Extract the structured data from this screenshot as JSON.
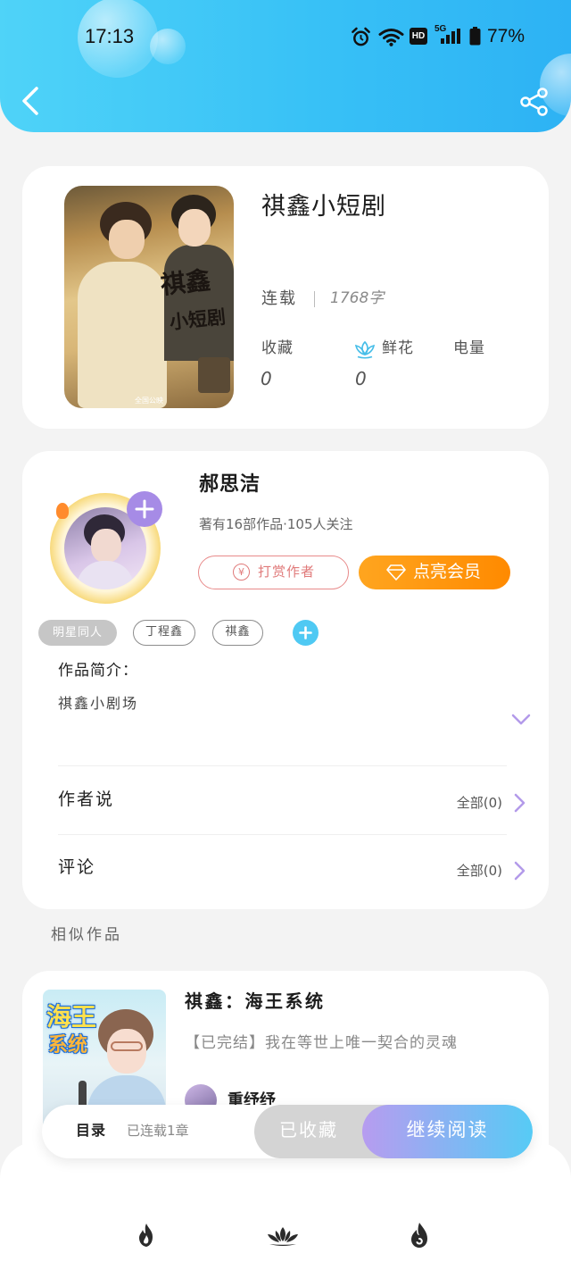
{
  "status_bar": {
    "time": "17:13",
    "hd_label": "HD",
    "network_label": "5G",
    "battery_percent": "77%",
    "icons": [
      "alarm-icon",
      "wifi-icon",
      "hd-icon",
      "signal-icon",
      "battery-icon"
    ]
  },
  "header": {
    "back_icon": "back-chevron-icon",
    "share_icon": "share-icon"
  },
  "book": {
    "title": "祺鑫小短剧",
    "status": "连载",
    "word_count": "1768字",
    "stats": [
      {
        "label": "收藏",
        "value": "0"
      },
      {
        "label": "鲜花",
        "value": "0",
        "icon": "lotus-icon"
      },
      {
        "label": "电量"
      }
    ],
    "cover": {
      "art_lines": [
        "祺鑫",
        "小短剧"
      ],
      "footer_text": "全国公映"
    }
  },
  "author": {
    "name": "郝思洁",
    "summary": "著有16部作品·105人关注",
    "follow_icon": "plus-icon",
    "reward": {
      "label": "打赏作者",
      "icon_glyph": "¥"
    },
    "vip": {
      "label": "点亮会员",
      "icon": "diamond-icon"
    }
  },
  "tags": {
    "items": [
      "明星同人",
      "丁程鑫",
      "祺鑫"
    ],
    "add_icon": "plus-icon"
  },
  "intro": {
    "heading": "作品简介：",
    "text": "祺鑫小剧场",
    "expand_icon": "chevron-down-icon"
  },
  "sections": [
    {
      "label": "作者说",
      "link": "全部(0)"
    },
    {
      "label": "评论",
      "link": "全部(0)"
    }
  ],
  "similar": {
    "heading": "相似作品",
    "items": [
      {
        "title": "祺鑫：海王系统",
        "description": "【已完结】我在等世上唯一契合的灵魂",
        "author": "重纾纾",
        "cover": {
          "art_lines": [
            "海王",
            "系统"
          ]
        }
      }
    ]
  },
  "bottom_bar": {
    "toc_label": "目录",
    "chapter_status": "已连载1章",
    "collected_label": "已收藏",
    "read_label": "继续阅读"
  },
  "bottom_nav": {
    "icons": [
      "fire-icon",
      "lotus-icon",
      "swirl-flame-icon"
    ]
  },
  "colors": {
    "header_start": "#4fd3f8",
    "header_end": "#2db2f4",
    "page_background": "#f3f3f3",
    "accent_purple": "#b39aea",
    "vip_orange": "#ff9a12",
    "reward_red": "#e07a7a",
    "tag_cyan": "#4fc9f3",
    "read_gradient_start": "#b79cf0",
    "read_gradient_end": "#56cbf5"
  }
}
